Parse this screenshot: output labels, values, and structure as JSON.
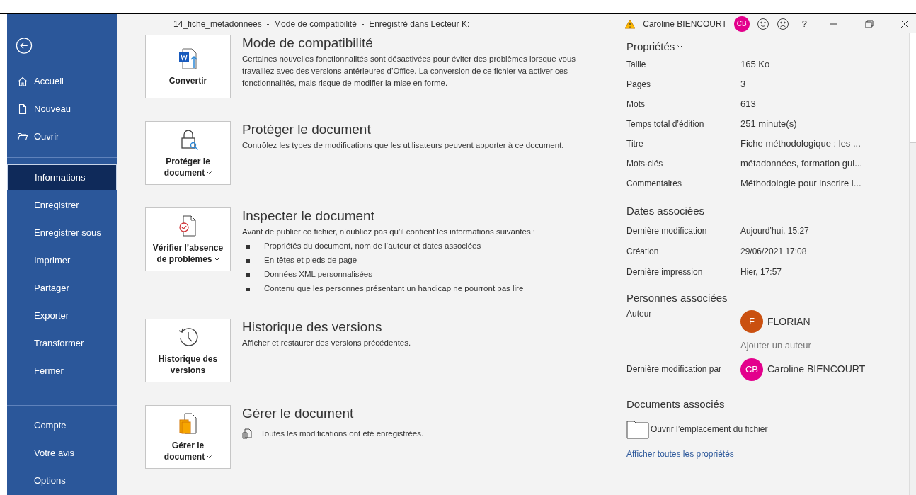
{
  "window": {
    "title": "14_fiche_metadonnees  -  Mode de compatibilité  -  Enregistré dans Lecteur K:",
    "user_name": "Caroline BIENCOURT",
    "user_initials": "CB",
    "help_label": "?"
  },
  "sidebar": {
    "groups": [
      [
        {
          "label": "Accueil",
          "kind": "home",
          "selected": false
        },
        {
          "label": "Nouveau",
          "kind": "new",
          "selected": false
        },
        {
          "label": "Ouvrir",
          "kind": "open",
          "selected": false
        }
      ],
      [
        {
          "label": "Informations",
          "selected": true
        },
        {
          "label": "Enregistrer",
          "selected": false
        },
        {
          "label": "Enregistrer sous",
          "selected": false
        },
        {
          "label": "Imprimer",
          "selected": false
        },
        {
          "label": "Partager",
          "selected": false
        },
        {
          "label": "Exporter",
          "selected": false
        },
        {
          "label": "Transformer",
          "selected": false
        },
        {
          "label": "Fermer",
          "selected": false
        }
      ],
      [
        {
          "label": "Compte",
          "selected": false
        },
        {
          "label": "Votre avis",
          "selected": false
        },
        {
          "label": "Options",
          "selected": false
        }
      ]
    ]
  },
  "sections": [
    {
      "kind": "convert",
      "button": {
        "label": "Convertir",
        "dropdown": false
      },
      "title": "Mode de compatibilité",
      "description": "Certaines nouvelles fonctionnalités sont désactivées pour éviter des problèmes lorsque vous travaillez avec des versions antérieures d’Office. La conversion de ce fichier va activer ces fonctionnalités, mais risque de modifier la mise en forme."
    },
    {
      "kind": "protect",
      "button": {
        "label": "Protéger le document",
        "dropdown": true
      },
      "title": "Protéger le document",
      "description": "Contrôlez les types de modifications que les utilisateurs peuvent apporter à ce document."
    },
    {
      "kind": "inspect",
      "button": {
        "label": "Vérifier l’absence de problèmes",
        "dropdown": true
      },
      "title": "Inspecter le document",
      "description": "Avant de publier ce fichier, n’oubliez pas qu’il contient les informations suivantes :",
      "bullets": [
        "Propriétés du document, nom de l’auteur et dates associées",
        "En-têtes et pieds de page",
        "Données XML personnalisées",
        "Contenu que les personnes présentant un handicap ne pourront pas lire"
      ]
    },
    {
      "kind": "history",
      "button": {
        "label": "Historique des versions",
        "dropdown": false
      },
      "title": "Historique des versions",
      "description": "Afficher et restaurer des versions précédentes."
    },
    {
      "kind": "manage",
      "button": {
        "label": "Gérer le document",
        "dropdown": true
      },
      "title": "Gérer le document",
      "status": "Toutes les modifications ont été enregistrées."
    }
  ],
  "properties": {
    "title": "Propriétés",
    "dropdown": true,
    "rows": [
      {
        "label": "Taille",
        "value": "165 Ko"
      },
      {
        "label": "Pages",
        "value": "3"
      },
      {
        "label": "Mots",
        "value": "613"
      },
      {
        "label": "Temps total d’édition",
        "value": "251 minute(s)"
      },
      {
        "label": "Titre",
        "value": "Fiche méthodologique : les ..."
      },
      {
        "label": "Mots-clés",
        "value": "métadonnées, formation gui..."
      },
      {
        "label": "Commentaires",
        "value": "Méthodologie pour inscrire l..."
      }
    ]
  },
  "dates": {
    "title": "Dates associées",
    "rows": [
      {
        "label": "Dernière modification",
        "value": "Aujourd’hui, 15:27"
      },
      {
        "label": "Création",
        "value": "29/06/2021 17:08"
      },
      {
        "label": "Dernière impression",
        "value": "Hier, 17:57"
      }
    ]
  },
  "people": {
    "title": "Personnes associées",
    "author": {
      "label": "Auteur",
      "name": "FLORIAN",
      "initials": "F",
      "color": "#ca5010"
    },
    "add_author": "Ajouter un auteur",
    "last_modified": {
      "label": "Dernière modification par",
      "name": "Caroline BIENCOURT",
      "initials": "CB",
      "color": "#e3008c"
    }
  },
  "related": {
    "title": "Documents associés",
    "open_location": "Ouvrir l’emplacement du fichier"
  },
  "show_all": "Afficher toutes les propriétés"
}
